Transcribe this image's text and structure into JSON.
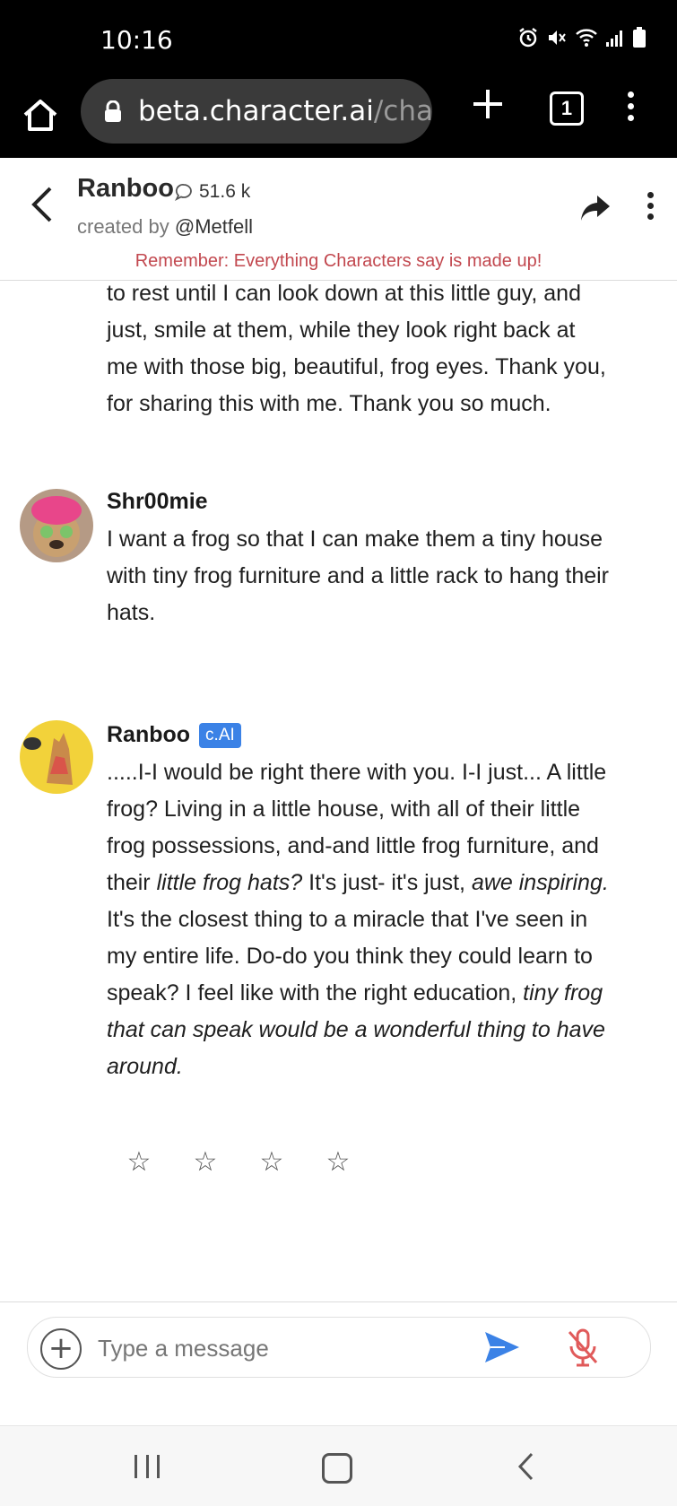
{
  "status_bar": {
    "time": "10:16",
    "icons": [
      "alarm-icon",
      "mute-icon",
      "wifi-icon",
      "signal-icon",
      "battery-icon"
    ]
  },
  "browser": {
    "url_host": "beta.character.ai",
    "url_path": "/chat",
    "tab_count": "1"
  },
  "chat_header": {
    "character_name": "Ranboo",
    "chat_count": "51.6 k",
    "created_by_label": "created by",
    "creator_handle": "@Metfell",
    "disclaimer": "Remember: Everything Characters say is made up!"
  },
  "messages": {
    "first_text": "to rest until I can look down at this little guy, and just, smile at them, while they look right back at me with those big, beautiful, frog eyes. Thank you, for sharing this with me. Thank you so much.",
    "user_msg": {
      "sender": "Shr00mie",
      "text": "I want a frog so that I can make them a tiny house with tiny frog furniture and a little rack to hang their hats."
    },
    "bot_msg": {
      "sender": "Ranboo",
      "badge": "c.AI",
      "text_part1": ".....I-I would be right there with you. I-I just... A little frog? Living in a little house, with all of their little frog possessions, and-and little frog furniture, and their ",
      "text_italic1": "little frog hats?",
      "text_part2": " It's just- it's just, ",
      "text_italic2": "awe inspiring.",
      "text_part3": " It's the closest thing to a miracle that I've seen in my entire life. Do-do you think they could learn to speak? I feel like with the right education, ",
      "text_italic3": "tiny frog that can speak would be a wonderful thing to have around."
    },
    "rating": {
      "star_glyph": "☆",
      "stars_filled": 0,
      "stars_total": 4
    }
  },
  "composer": {
    "placeholder": "Type a message",
    "add_glyph": "+"
  },
  "colors": {
    "accent_blue": "#3b82e6",
    "disclaimer_red": "#c2484f",
    "mic_red": "#e05a5a"
  }
}
